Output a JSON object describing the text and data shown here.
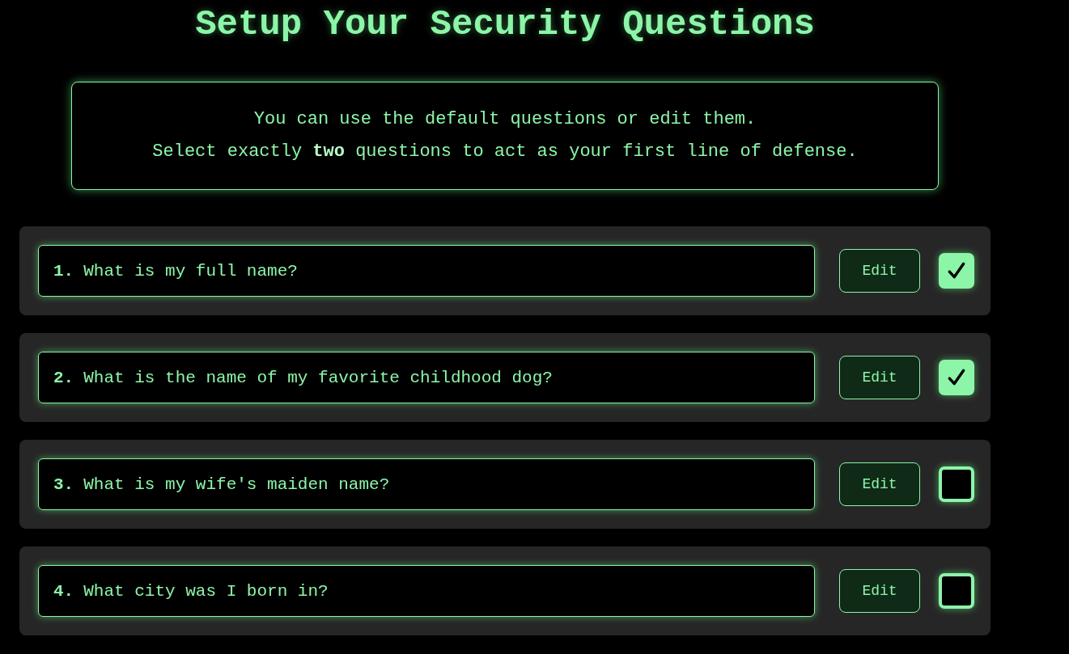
{
  "title": "Setup Your Security Questions",
  "intro": [
    "You can use the default questions or edit them.",
    "Select exactly **two** questions to act as your first line of defense."
  ],
  "questions": [
    {
      "number": "1.",
      "text": "What is my full name?",
      "edit_label": "Edit",
      "checked": true
    },
    {
      "number": "2.",
      "text": "What is the name of my favorite childhood dog?",
      "edit_label": "Edit",
      "checked": true
    },
    {
      "number": "3.",
      "text": "What is my wife's maiden name?",
      "edit_label": "Edit",
      "checked": false
    },
    {
      "number": "4.",
      "text": "What city was I born in?",
      "edit_label": "Edit",
      "checked": false
    }
  ]
}
